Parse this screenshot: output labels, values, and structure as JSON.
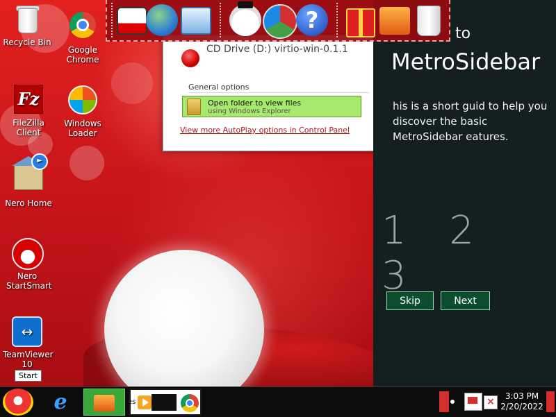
{
  "desktop_icons": [
    {
      "label": "Recycle Bin",
      "icon": "recycle-bin-icon"
    },
    {
      "label": "Google Chrome",
      "icon": "chrome-icon"
    },
    {
      "label": "FileZilla Client",
      "icon": "filezilla-icon"
    },
    {
      "label": "Windows Loader",
      "icon": "windows-loader-icon"
    },
    {
      "label": "Nero Home",
      "icon": "nero-home-icon"
    },
    {
      "label": "Nero StartSmart",
      "icon": "nero-startsmart-icon"
    },
    {
      "label": "TeamViewer 10",
      "icon": "teamviewer-icon"
    }
  ],
  "start_tooltip": "Start",
  "autoplay": {
    "drive_title": "CD Drive (D:) virtio-win-0.1.1",
    "section_label": "General options",
    "option_title": "Open folder to view files",
    "option_subtitle": "using Windows Explorer",
    "more_link": "View more AutoPlay options in Control Panel"
  },
  "metro_sidebar": {
    "title_to": "to",
    "title": "MetroSidebar",
    "description": "his is a short guid to help you discover the basic MetroSidebar eatures.",
    "steps": "1 2 3",
    "skip_label": "Skip",
    "next_label": "Next"
  },
  "dock": {
    "items": [
      "santa-computer-icon",
      "globe-network-icon",
      "control-panel-icon",
      "snowman-icon",
      "windows-shield-icon",
      "help-icon",
      "gift-icon",
      "folder-icon",
      "trash-icon"
    ]
  },
  "taskbar": {
    "partial_label": "es",
    "time": "3:03 PM",
    "date": "2/20/2022"
  },
  "colors": {
    "desktop_red": "#c0161a",
    "metro_bg": "#13201f",
    "metro_button": "#0b4d2c",
    "autoplay_option": "#a7e86e",
    "link_red": "#b5121b"
  }
}
